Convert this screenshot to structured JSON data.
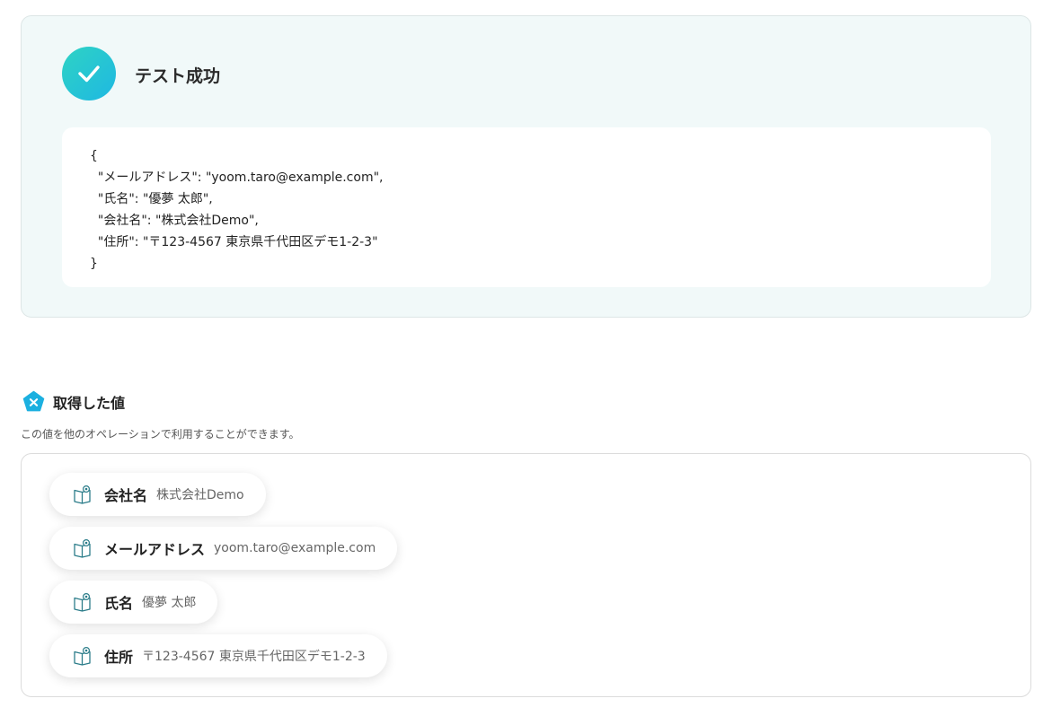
{
  "test_result": {
    "title": "テスト成功",
    "json_lines": [
      "{",
      "  \"メールアドレス\": \"yoom.taro@example.com\",",
      "  \"氏名\": \"優夢 太郎\",",
      "  \"会社名\": \"株式会社Demo\",",
      "  \"住所\": \"〒123-4567 東京県千代田区デモ1-2-3\"",
      "}"
    ]
  },
  "acquired": {
    "title": "取得した値",
    "description": "この値を他のオペレーションで利用することができます。",
    "items": [
      {
        "key": "会社名",
        "value": "株式会社Demo",
        "icon": "book-icon"
      },
      {
        "key": "メールアドレス",
        "value": "yoom.taro@example.com",
        "icon": "book-icon"
      },
      {
        "key": "氏名",
        "value": "優夢 太郎",
        "icon": "book-icon"
      },
      {
        "key": "住所",
        "value": "〒123-4567 東京県千代田区デモ1-2-3",
        "icon": "book-icon"
      }
    ]
  },
  "colors": {
    "accent_gradient_start": "#2ed3c4",
    "accent_gradient_end": "#1fb8e2",
    "icon_blue": "#1cb0e0",
    "icon_stroke": "#2c7d8a"
  }
}
